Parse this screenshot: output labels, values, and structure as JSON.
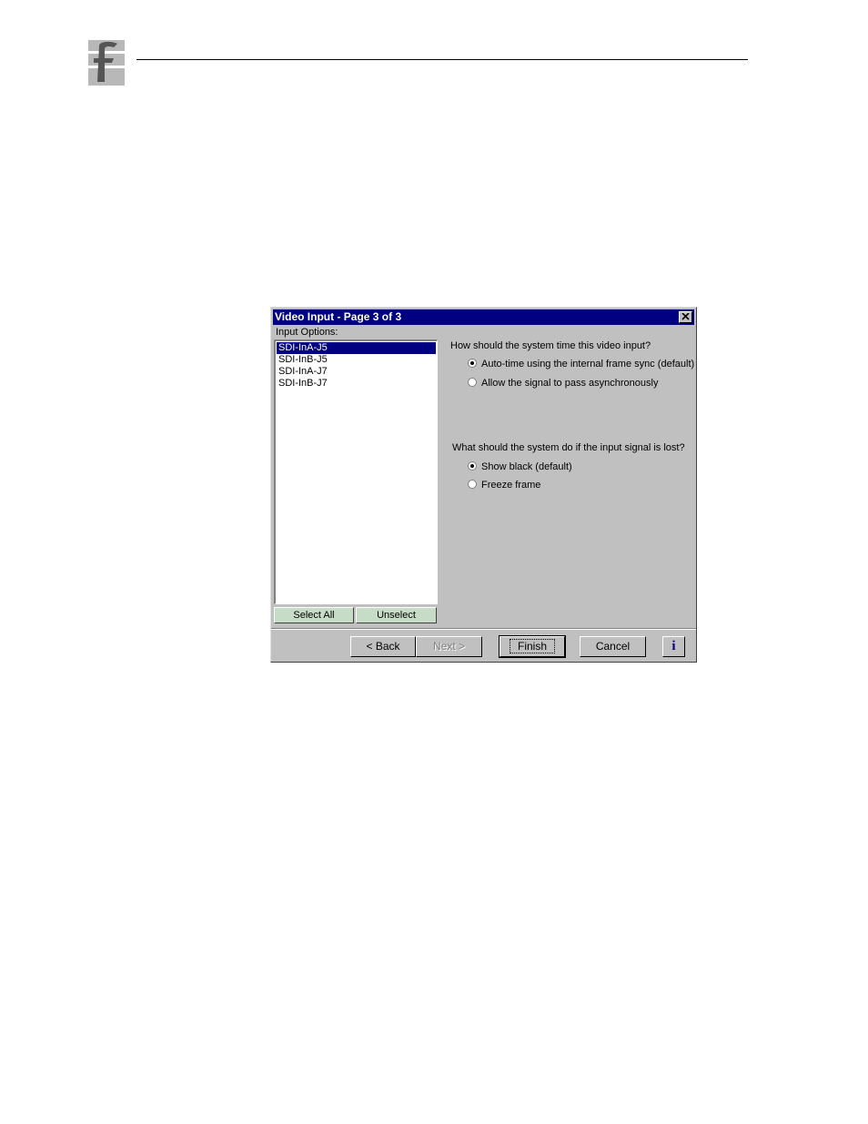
{
  "dialog": {
    "title": "Video Input - Page 3 of 3",
    "input_options_label": "Input Options:",
    "list_items": [
      {
        "label": "SDI-InA-J5",
        "selected": true
      },
      {
        "label": "SDI-InB-J5",
        "selected": false
      },
      {
        "label": "SDI-InA-J7",
        "selected": false
      },
      {
        "label": "SDI-InB-J7",
        "selected": false
      }
    ],
    "select_all_label": "Select All",
    "unselect_label": "Unselect",
    "timing": {
      "question": "How should the system time this video input?",
      "options": [
        {
          "label": "Auto-time using the internal frame sync (default)",
          "checked": true
        },
        {
          "label": "Allow the signal to pass asynchronously",
          "checked": false
        }
      ]
    },
    "signal_loss": {
      "question": "What should the system do if the input signal is lost?",
      "options": [
        {
          "label": "Show black (default)",
          "checked": true
        },
        {
          "label": "Freeze frame",
          "checked": false
        }
      ]
    },
    "buttons": {
      "back": "< Back",
      "next": "Next >",
      "finish": "Finish",
      "cancel": "Cancel",
      "info": "i"
    }
  },
  "colors": {
    "titlebar": "#000080",
    "dialog_bg": "#c0c0c0",
    "green_button": "#c6dcc6"
  }
}
